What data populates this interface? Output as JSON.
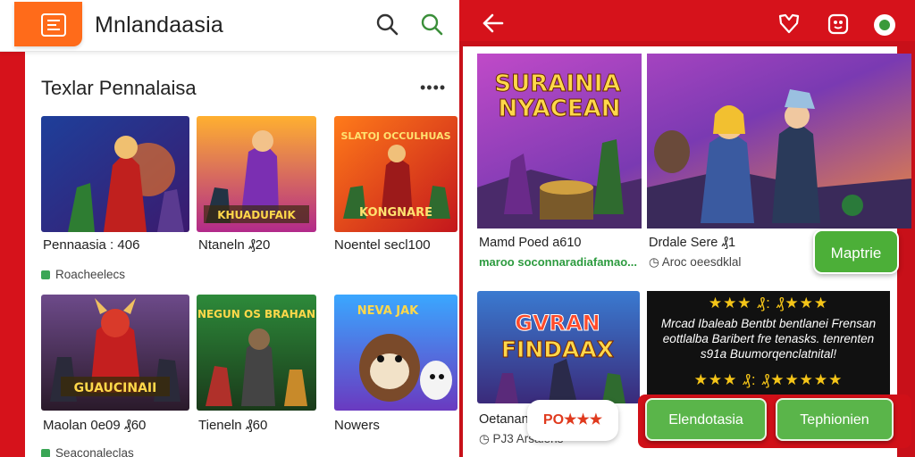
{
  "left": {
    "app_title": "Mnlandaasia",
    "section_title": "Texlar Pennalaisa",
    "more": "••••",
    "cards": [
      {
        "caption": "Pennaasia : 406",
        "meta": "Roacheelecs",
        "art": "KHUADUFAIK"
      },
      {
        "caption": "Ntaneln ₰20",
        "art": "SLATOJ OCCULHUAS"
      },
      {
        "caption": "Noentel secl100",
        "art": "KONGNARE"
      },
      {
        "caption": "Maolan 0e09 ₰60",
        "meta": "Seaconaleclas",
        "art": "GUAUCINAII"
      },
      {
        "caption": "Tieneln ₰60",
        "art": "NEGUN OS BRAHAN"
      },
      {
        "caption": "Nowers",
        "art": "NEVA JAK"
      }
    ]
  },
  "right": {
    "hero_title_1": "SURAINIA",
    "hero_title_2": "NYACEAN",
    "hero_caption_1": "Mamd Poed a610",
    "hero_green": "maroo soconnaradiafamao...",
    "hero_caption_2": "Drdale Sere ₰1",
    "hero_meta_2": "Aroc oeesdklal",
    "card2_title_1": "GVRAN",
    "card2_title_2": "FINDAAX",
    "card2_caption": "Oetanan",
    "card2_meta": "PJ3 Arsalens",
    "dark_stars_top": "★★★ ₰: ₰★★★",
    "dark_text": "Mrcad Ibaleab Bentbt bentlanei Frensan eottlalba Baribert fre tenasks. tenrenten s91a Buumorqenclatnital!",
    "dark_stars_bottom": "★★★ ₰: ₰★★★★★",
    "bubble_label": "Maptrie",
    "promo_label": "PO★★★",
    "btn_left": "Elendotasia",
    "btn_right": "Tephionien"
  },
  "colors": {
    "brand_red": "#d6121b",
    "accent_orange": "#ff6b1a",
    "green": "#4caf38"
  }
}
